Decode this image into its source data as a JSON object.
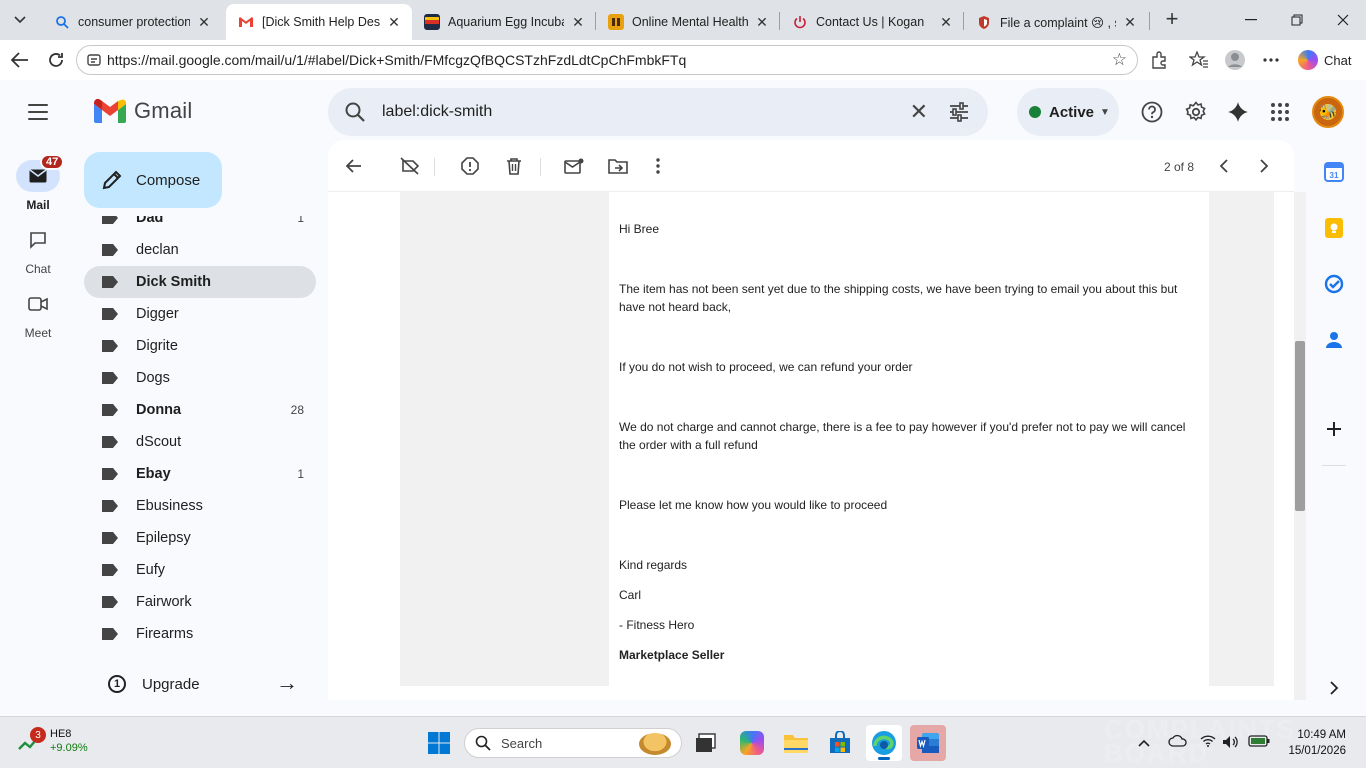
{
  "browser": {
    "tabs": [
      {
        "title": "consumer protection co",
        "favicon": "search-favicon",
        "color": "#1a73e8"
      },
      {
        "title": "[Dick Smith Help Desk] I",
        "favicon": "gmail-favicon",
        "color": "#ea4335"
      },
      {
        "title": "Aquarium Egg Incubator",
        "favicon": "store-favicon",
        "color": "#1f2a44"
      },
      {
        "title": "Online Mental Health Tr",
        "favicon": "health-favicon",
        "color": "#e8a210"
      },
      {
        "title": "Contact Us | Kogan",
        "favicon": "power-favicon",
        "color": "#c81e3a"
      },
      {
        "title": "File a complaint 😢 , sha",
        "favicon": "shield-favicon",
        "color": "#c0392b"
      }
    ],
    "url": "https://mail.google.com/mail/u/1/#label/Dick+Smith/FMfcgzQfBQCSTzhFzdLdtCpChFmbkFTq",
    "chat_label": "Chat"
  },
  "gmail": {
    "brand": "Gmail",
    "search_query": "label:dick-smith",
    "status": "Active",
    "rail": [
      {
        "label": "Mail",
        "badge": "47"
      },
      {
        "label": "Chat"
      },
      {
        "label": "Meet"
      }
    ],
    "compose_label": "Compose",
    "labels": [
      {
        "name": "Dad",
        "count": "1",
        "bold": true
      },
      {
        "name": "declan",
        "count": ""
      },
      {
        "name": "Dick Smith",
        "count": "",
        "selected": true
      },
      {
        "name": "Digger",
        "count": ""
      },
      {
        "name": "Digrite",
        "count": ""
      },
      {
        "name": "Dogs",
        "count": ""
      },
      {
        "name": "Donna",
        "count": "28",
        "bold": true
      },
      {
        "name": "dScout",
        "count": ""
      },
      {
        "name": "Ebay",
        "count": "1",
        "bold": true
      },
      {
        "name": "Ebusiness",
        "count": ""
      },
      {
        "name": "Epilepsy",
        "count": ""
      },
      {
        "name": "Eufy",
        "count": ""
      },
      {
        "name": "Fairwork",
        "count": ""
      },
      {
        "name": "Firearms",
        "count": ""
      }
    ],
    "upgrade_label": "Upgrade",
    "pager": "2 of 8",
    "message": {
      "greeting": "Hi Bree",
      "p1": "The item has not been sent yet due to the shipping costs, we have been trying to email you about this but have not heard back,",
      "p2": "If you do not wish to proceed, we can refund your order",
      "p3": "We do not charge and cannot charge, there is a fee to pay however if you'd prefer not to pay we will cancel the order with a full refund",
      "p4": "Please let me know how you would like to proceed",
      "closing": "Kind regards",
      "name": "Carl",
      "company": "- Fitness Hero",
      "role": "Marketplace Seller"
    }
  },
  "taskbar": {
    "stock_name": "HE8",
    "stock_change": "+9.09%",
    "stock_badge": "3",
    "search_label": "Search",
    "time": "10:49 AM",
    "date": "15/01/2026",
    "watermark": "COMPLAINTS BOARD"
  }
}
